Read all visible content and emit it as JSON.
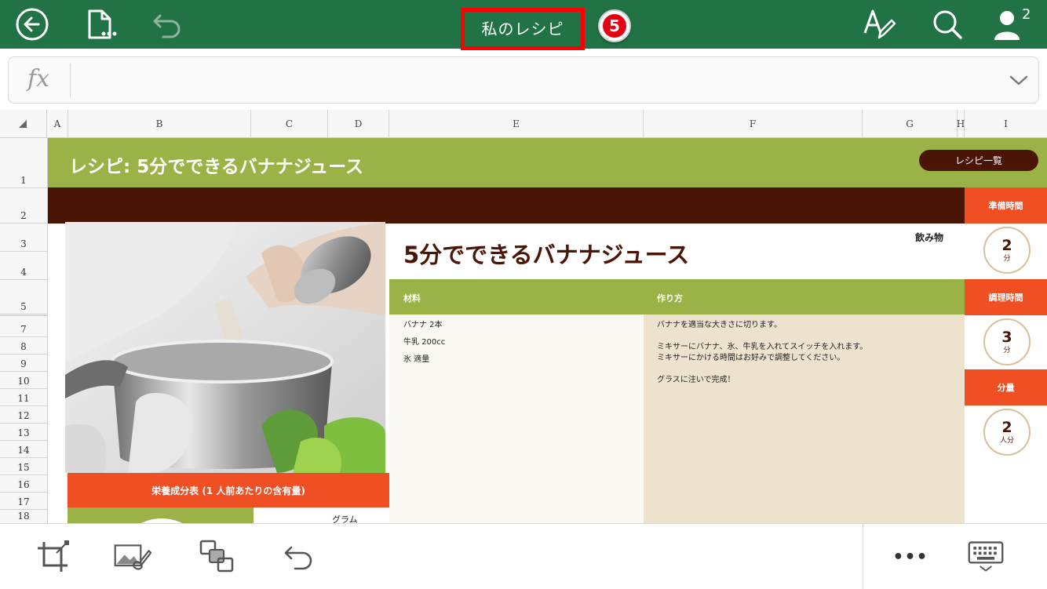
{
  "topbar": {
    "title": "私のレシピ",
    "step_badge": "5",
    "user_count": "2",
    "colors": {
      "bg": "#217346",
      "highlight_border": "#ff0000",
      "badge": "#e60012"
    },
    "icons": [
      "back-icon",
      "file-menu-icon",
      "undo-icon",
      "text-edit-icon",
      "search-icon",
      "share-user-icon"
    ]
  },
  "formula_bar": {
    "label": "fx",
    "value": ""
  },
  "columns": [
    "A",
    "B",
    "C",
    "D",
    "E",
    "F",
    "G",
    "H",
    "I"
  ],
  "rows": [
    "1",
    "2",
    "3",
    "4",
    "5",
    "7",
    "8",
    "9",
    "10",
    "11",
    "12",
    "13",
    "14",
    "15",
    "16",
    "17",
    "18"
  ],
  "sheet": {
    "banner_title": "レシピ: 5分でできるバナナジュース",
    "recipe_list_button": "レシピ一覧",
    "dish_title": "5分でできるバナナジュース",
    "category": "飲み物",
    "ingredients_label": "材料",
    "method_label": "作り方",
    "ingredients": [
      "バナナ 2本",
      "牛乳 200cc",
      "氷 適量"
    ],
    "method": [
      "バナナを適当な大きさに切ります。",
      "",
      "ミキサーにバナナ、氷、牛乳を入れてスイッチを入れます。",
      "ミキサーにかける時間はお好みで調整してください。",
      "",
      "グラスに注いで完成！"
    ],
    "nutrition_header": "栄養成分表 (1 人前あたりの含有量)",
    "gram_label": "グラム",
    "prep": {
      "label": "準備時間",
      "value": "2",
      "unit": "分"
    },
    "cook": {
      "label": "調理時間",
      "value": "3",
      "unit": "分"
    },
    "servings": {
      "label": "分量",
      "value": "2",
      "unit": "人分"
    },
    "colors": {
      "green": "#9bb246",
      "brown": "#4a1504",
      "orange": "#f04e23",
      "beige": "#ede2cd"
    }
  },
  "bottombar": {
    "icons": [
      "crop-icon",
      "picture-styles-icon",
      "arrange-icon",
      "undo-icon",
      "more-icon",
      "keyboard-icon"
    ],
    "more_label": "•••"
  }
}
